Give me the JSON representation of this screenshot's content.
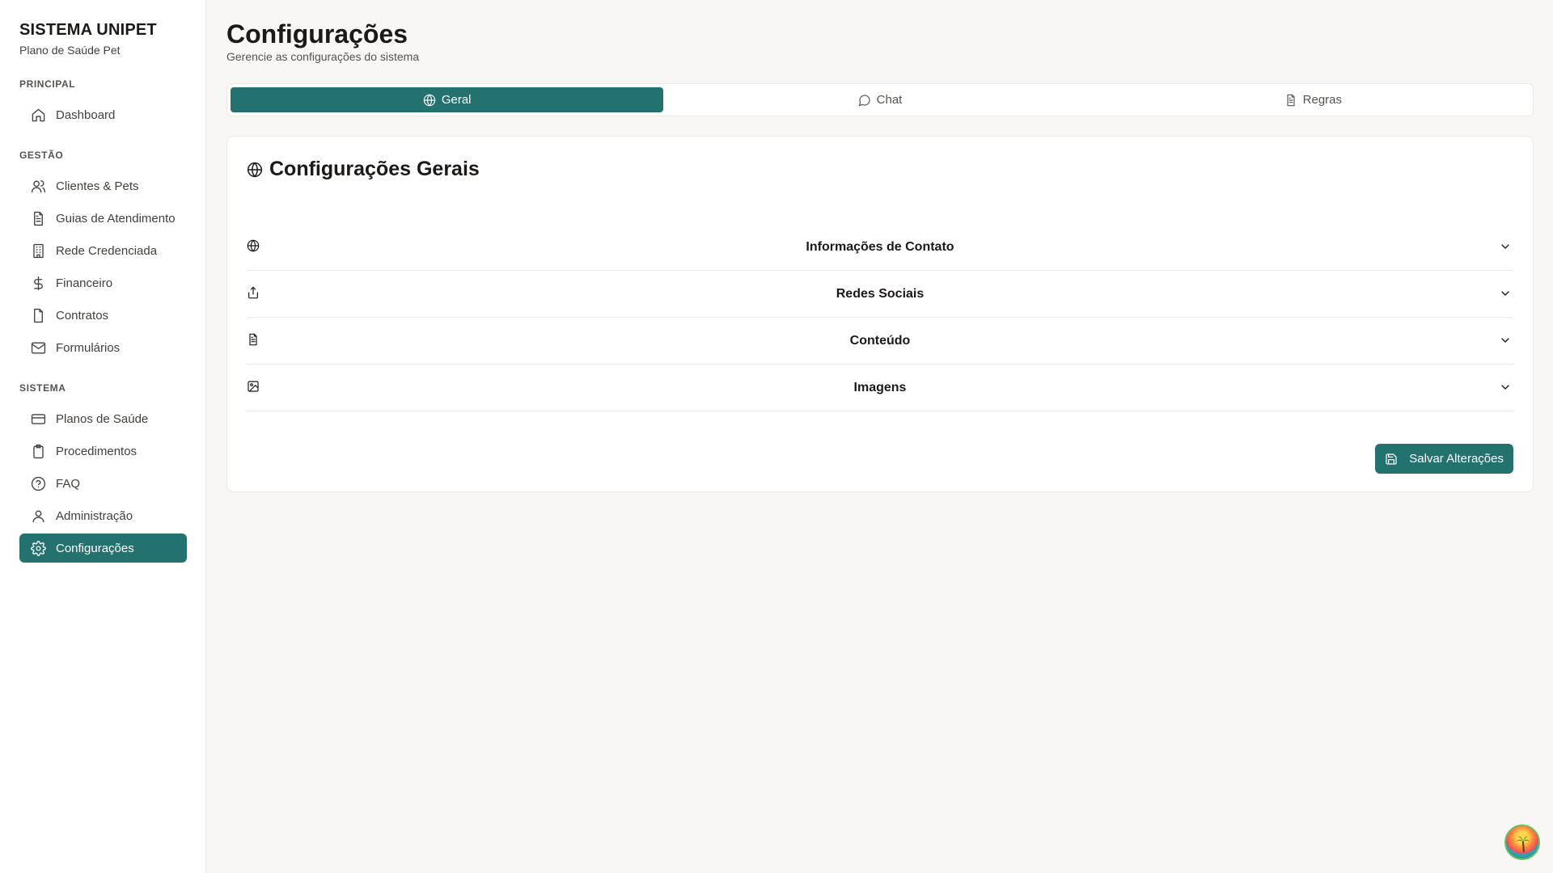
{
  "sidebar": {
    "brand_title": "SISTEMA UNIPET",
    "brand_subtitle": "Plano de Saúde Pet",
    "sections": {
      "principal": "PRINCIPAL",
      "gestao": "GESTÃO",
      "sistema": "SISTEMA"
    },
    "items": [
      {
        "label": "Dashboard",
        "icon": "home-icon"
      },
      {
        "label": "Clientes & Pets",
        "icon": "users-icon"
      },
      {
        "label": "Guias de Atendimento",
        "icon": "file-text-icon"
      },
      {
        "label": "Rede Credenciada",
        "icon": "building-icon"
      },
      {
        "label": "Financeiro",
        "icon": "dollar-icon"
      },
      {
        "label": "Contratos",
        "icon": "file-icon"
      },
      {
        "label": "Formulários",
        "icon": "mail-icon"
      },
      {
        "label": "Planos de Saúde",
        "icon": "credit-card-icon"
      },
      {
        "label": "Procedimentos",
        "icon": "clipboard-icon"
      },
      {
        "label": "FAQ",
        "icon": "help-circle-icon"
      },
      {
        "label": "Administração",
        "icon": "user-icon"
      },
      {
        "label": "Configurações",
        "icon": "gear-icon",
        "active": true
      }
    ]
  },
  "header": {
    "title": "Configurações",
    "subtitle": "Gerencie as configurações do sistema"
  },
  "tabs": [
    {
      "label": "Geral",
      "icon": "globe-icon",
      "active": true
    },
    {
      "label": "Chat",
      "icon": "chat-icon"
    },
    {
      "label": "Regras",
      "icon": "file-text-icon"
    }
  ],
  "card": {
    "title": "Configurações Gerais",
    "icon": "globe-icon",
    "accordion": [
      {
        "label": "Informações de Contato",
        "icon": "globe-icon"
      },
      {
        "label": "Redes Sociais",
        "icon": "share-icon"
      },
      {
        "label": "Conteúdo",
        "icon": "file-text-icon"
      },
      {
        "label": "Imagens",
        "icon": "image-icon"
      }
    ],
    "save_label": "Salvar Alterações"
  },
  "colors": {
    "accent": "#24726f",
    "background": "#f8f7f5",
    "surface": "#ffffff"
  }
}
